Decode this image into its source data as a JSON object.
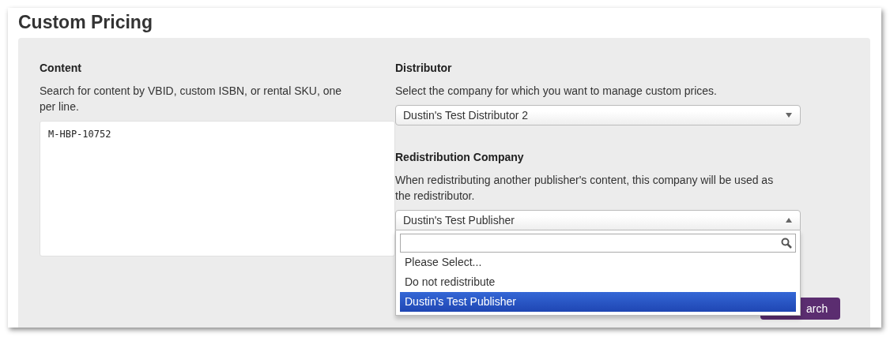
{
  "title": "Custom Pricing",
  "content": {
    "label": "Content",
    "help": "Search for content by VBID, custom ISBN, or rental SKU, one per line.",
    "value": "M-HBP-10752"
  },
  "distributor": {
    "label": "Distributor",
    "help": "Select the company for which you want to manage custom prices.",
    "value": "Dustin's Test Distributor 2",
    "expanded": false
  },
  "redistribution": {
    "label": "Redistribution Company",
    "help": "When redistributing another publisher's content, this company will be used as the redistributor.",
    "value": "Dustin's Test Publisher",
    "expanded": true,
    "options": [
      {
        "label": "Please Select...",
        "selected": false
      },
      {
        "label": "Do not redistribute",
        "selected": false
      },
      {
        "label": "Dustin's Test Publisher",
        "selected": true
      }
    ]
  },
  "search_button": {
    "label": "arch"
  }
}
